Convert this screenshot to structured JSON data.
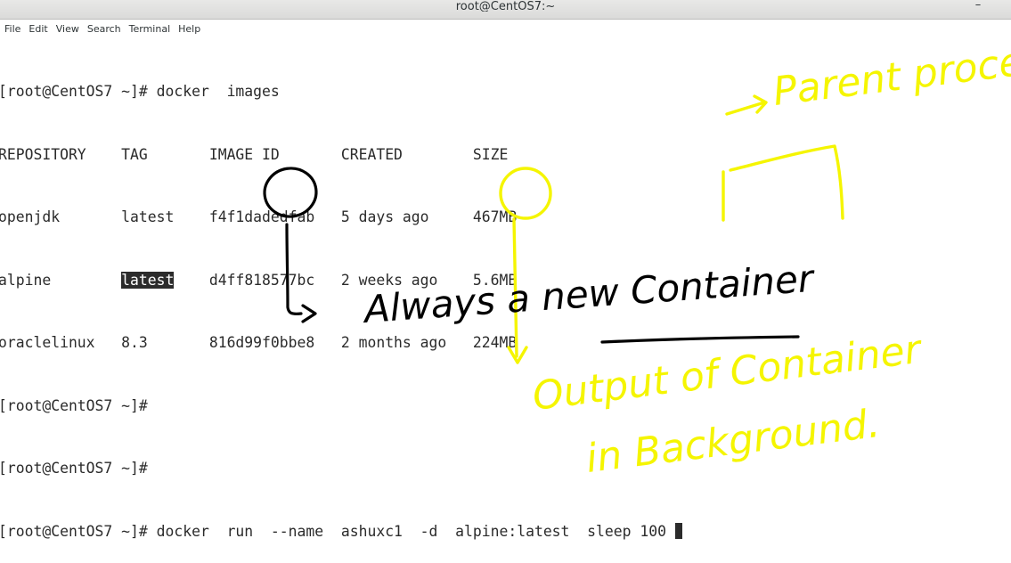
{
  "window": {
    "title": "root@CentOS7:~",
    "minimize_glyph": "–"
  },
  "menu": [
    "File",
    "Edit",
    "View",
    "Search",
    "Terminal",
    "Help"
  ],
  "terminal": {
    "lines": [
      "[root@CentOS7 ~]# docker  images",
      "REPOSITORY    TAG       IMAGE ID       CREATED        SIZE",
      "openjdk       latest    f4f1dadedfab   5 days ago     467MB"
    ],
    "alpine_row": {
      "repo_pad": "alpine        ",
      "tag": "latest",
      "rest": "    d4ff818577bc   2 weeks ago    5.6MB"
    },
    "lines_after": [
      "oraclelinux   8.3       816d99f0bbe8   2 months ago   224MB",
      "[root@CentOS7 ~]#",
      "[root@CentOS7 ~]#"
    ],
    "current_command": "[root@CentOS7 ~]# docker  run  --name  ashuxc1  -d  alpine:latest  sleep 100 "
  },
  "annotations": {
    "parent_process": "Parent process",
    "always_new_container": "Always a new Container",
    "output_background": [
      "Output of Container",
      "in Background."
    ],
    "ink_color_yellow": "#f5f500",
    "ink_color_black": "#000000"
  }
}
